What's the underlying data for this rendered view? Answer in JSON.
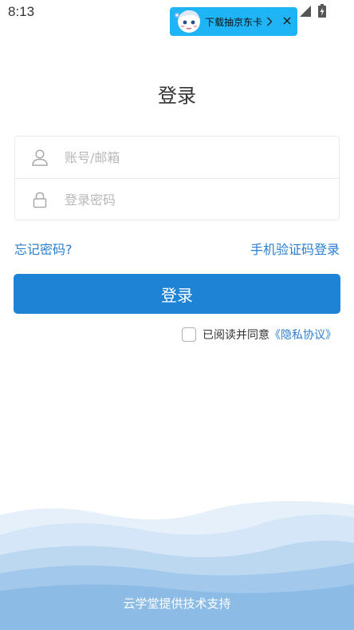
{
  "status_bar": {
    "time": "8:13"
  },
  "promo_banner": {
    "text": "下载抽京东卡",
    "chevron": ">",
    "close_icon": "close-icon",
    "background_color": "#1fb4f6"
  },
  "login": {
    "title": "登录",
    "account_field": {
      "placeholder": "账号/邮箱",
      "value": "",
      "icon": "user-icon"
    },
    "password_field": {
      "placeholder": "登录密码",
      "value": "",
      "icon": "lock-icon"
    },
    "forgot_password_link": "忘记密码?",
    "sms_login_link": "手机验证码登录",
    "submit_button": "登录",
    "agreement": {
      "checked": false,
      "text": "已阅读并同意",
      "link": "《隐私协议》"
    }
  },
  "footer": {
    "text": "云学堂提供技术支持"
  },
  "colors": {
    "primary": "#1f83d5",
    "link": "#2a7fd0",
    "placeholder": "#b8b8b8",
    "text": "#333333"
  }
}
